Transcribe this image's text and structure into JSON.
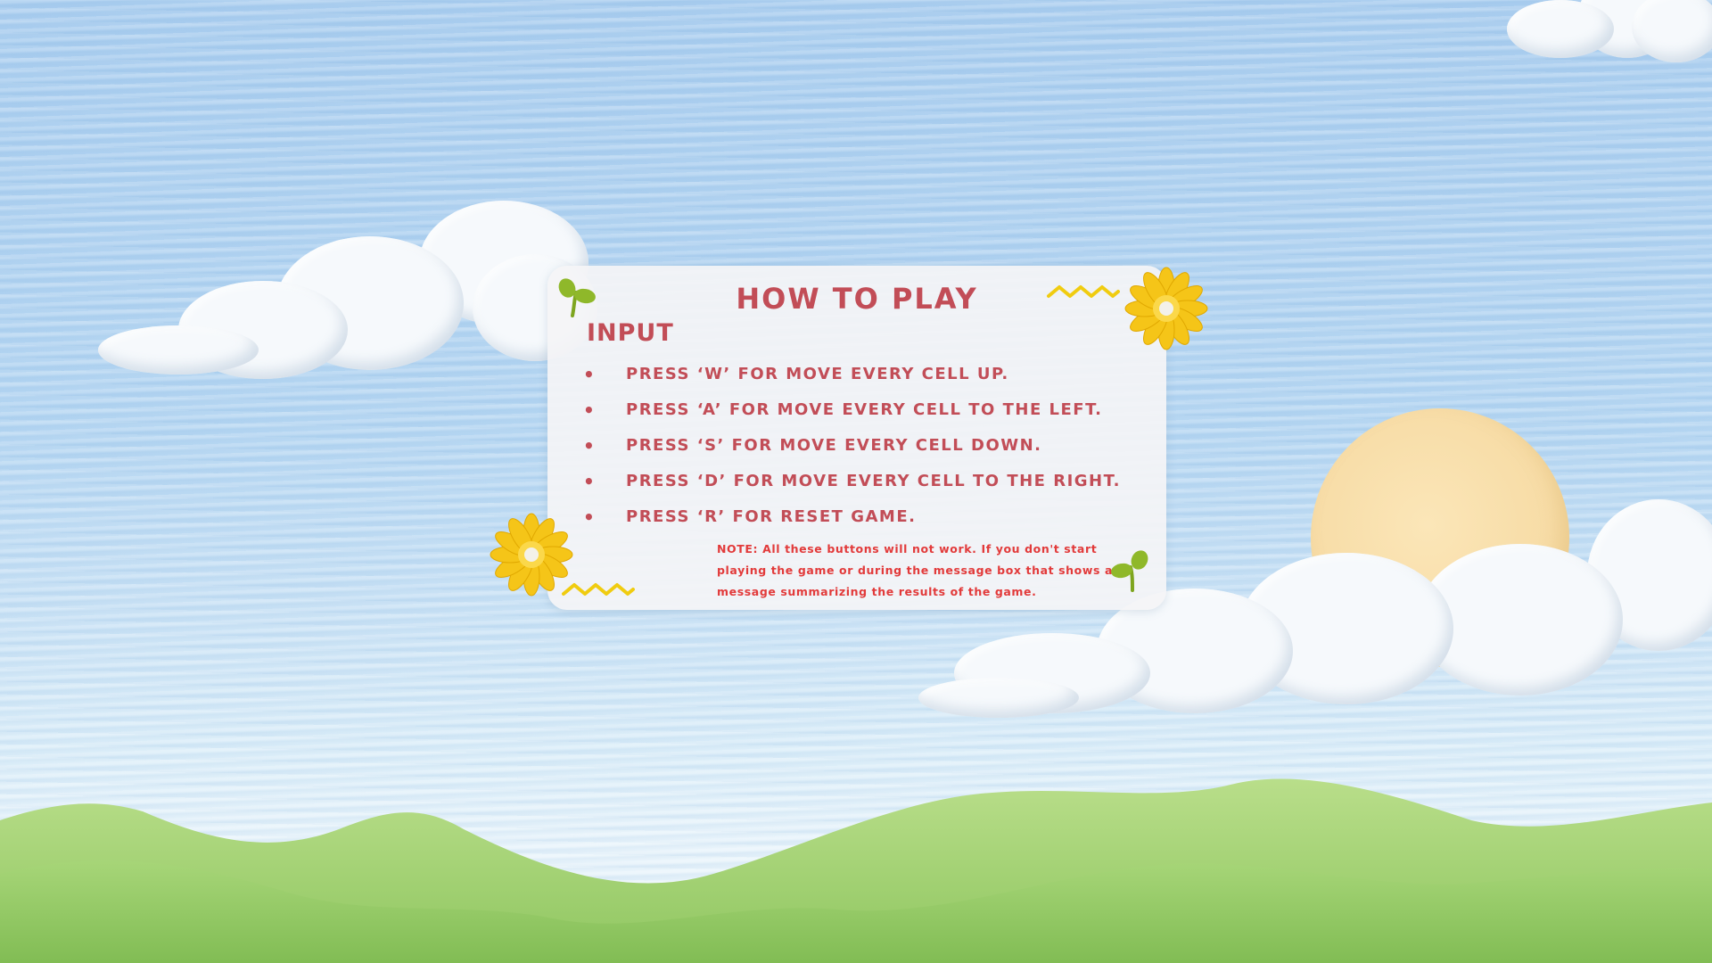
{
  "screen": "how-to-play",
  "colors": {
    "title": "#c24d57",
    "note": "#e23a3a",
    "panel": "#f4f4f6",
    "sky": "#a9cdef",
    "grass": "#9fcf6f",
    "sun": "#f7dca6",
    "flower": "#f5c518",
    "sprout": "#8fb82a"
  },
  "panel": {
    "title": "HOW TO PLAY",
    "section_title": "INPUT",
    "rules": [
      "PRESS ‘W’ FOR MOVE EVERY CELL UP.",
      "PRESS ‘A’ FOR MOVE EVERY CELL TO THE LEFT.",
      "PRESS ‘S’ FOR MOVE EVERY CELL DOWN.",
      "PRESS ‘D’ FOR MOVE EVERY CELL TO THE RIGHT.",
      "PRESS ‘R’ FOR RESET GAME."
    ],
    "note": "NOTE: All these buttons will not work. If you don't start playing the game or during the message box that shows a message summarizing the results of the game."
  },
  "decorations": [
    "cloud",
    "sun",
    "hills",
    "flower-icon",
    "sprout-icon",
    "zigzag"
  ]
}
